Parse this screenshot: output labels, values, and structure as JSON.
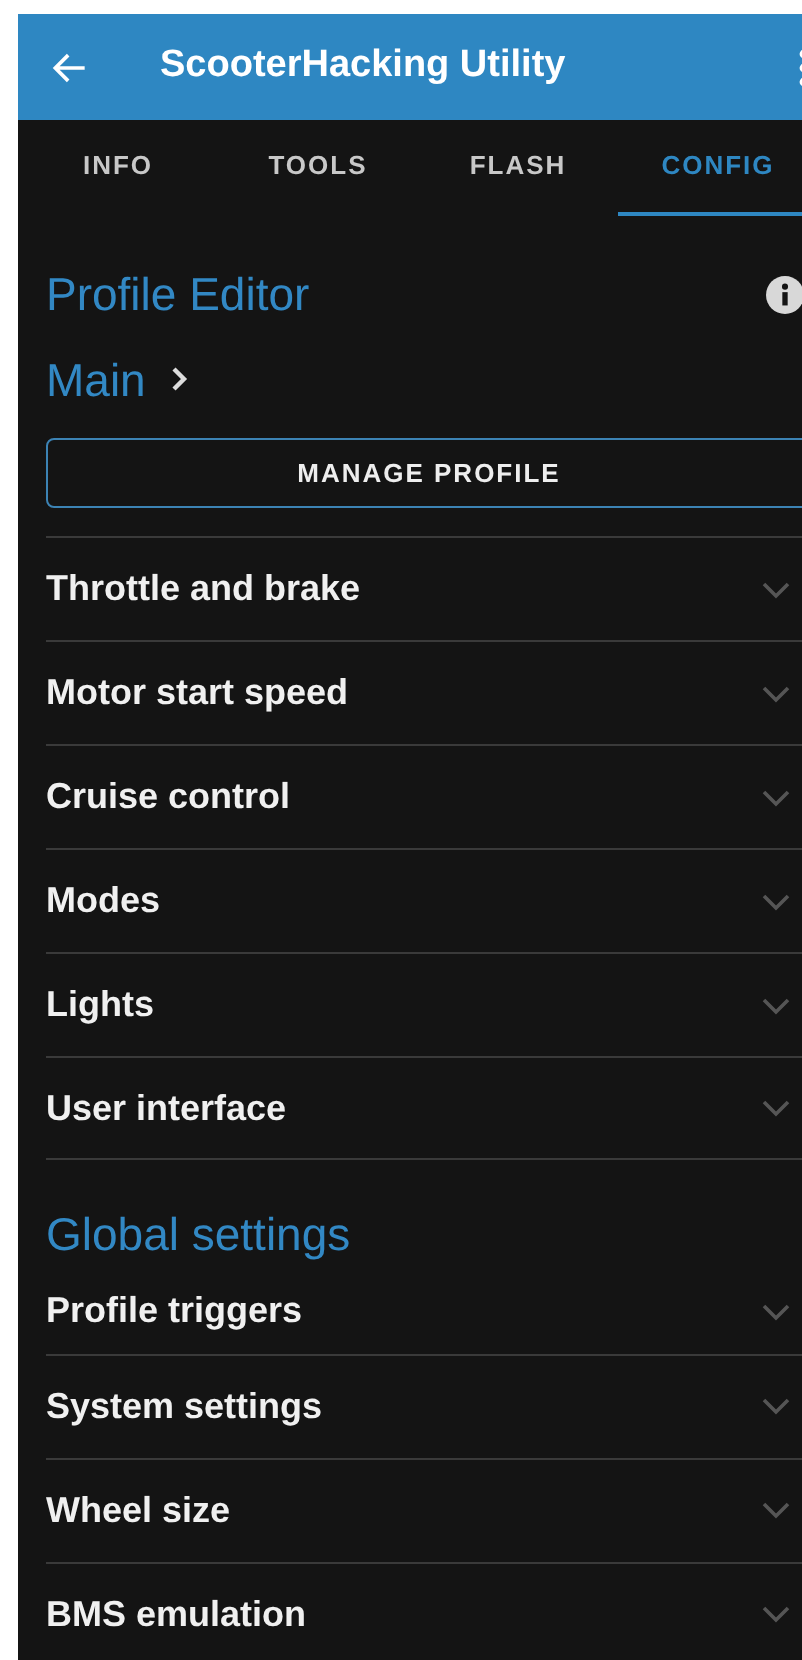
{
  "app_bar": {
    "title": "ScooterHacking Utility"
  },
  "tabs": [
    {
      "label": "INFO",
      "selected": false
    },
    {
      "label": "TOOLS",
      "selected": false
    },
    {
      "label": "FLASH",
      "selected": false
    },
    {
      "label": "CONFIG",
      "selected": true
    }
  ],
  "profile_editor": {
    "heading": "Profile Editor",
    "profile": "Main",
    "button": "MANAGE PROFILE",
    "sections": [
      {
        "label": "Throttle and brake",
        "expanded": false
      },
      {
        "label": "Motor start speed",
        "expanded": false
      },
      {
        "label": "Cruise control",
        "expanded": false
      },
      {
        "label": "Modes",
        "expanded": false
      },
      {
        "label": "Lights",
        "expanded": false
      },
      {
        "label": "User interface",
        "expanded": false
      }
    ]
  },
  "global_settings": {
    "heading": "Global settings",
    "sections": [
      {
        "label": "Profile triggers",
        "expanded": false
      },
      {
        "label": "System settings",
        "expanded": false
      },
      {
        "label": "Wheel size",
        "expanded": false
      },
      {
        "label": "BMS emulation",
        "expanded": false
      }
    ]
  }
}
